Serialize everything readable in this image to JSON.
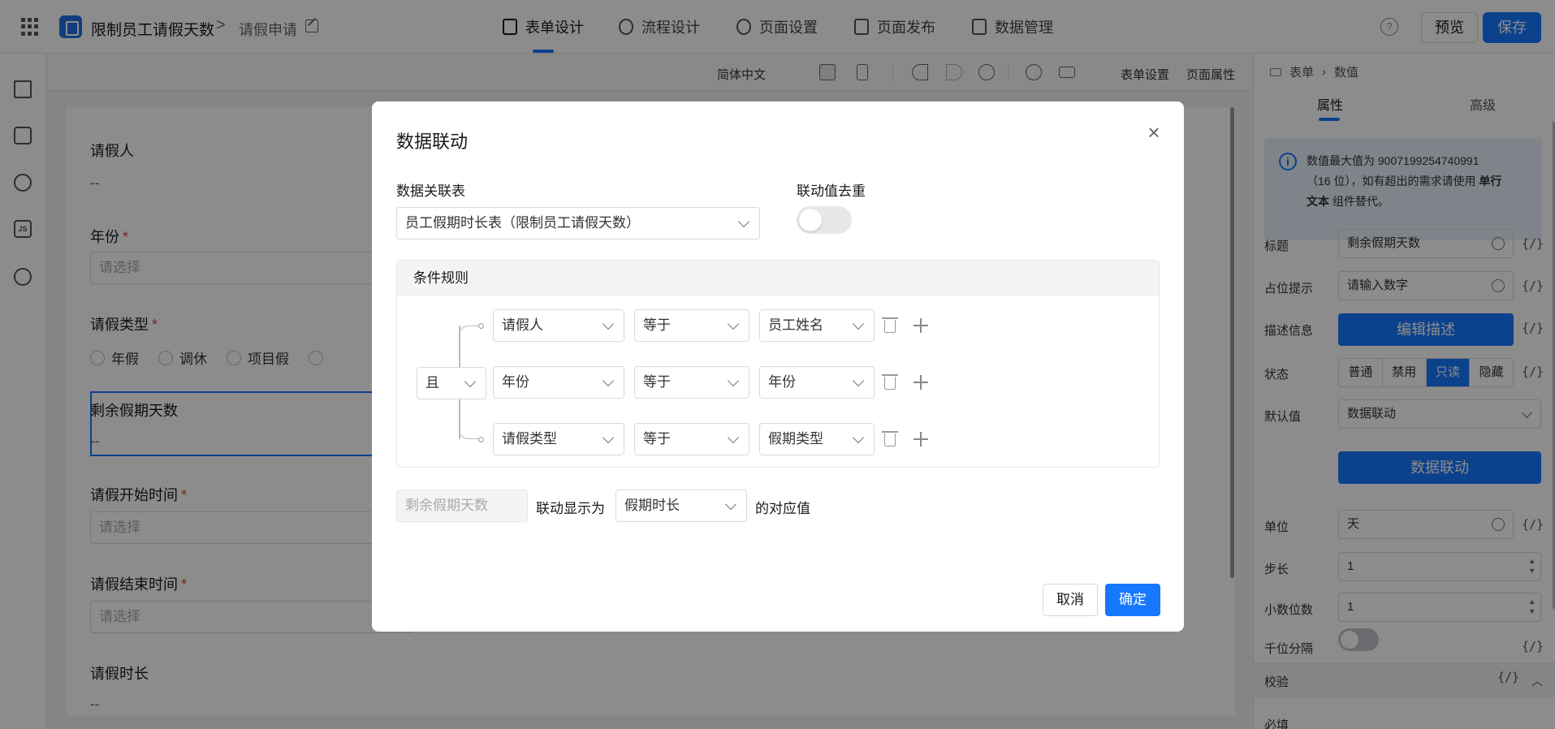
{
  "header": {
    "app_name": "限制员工请假天数",
    "crumb_sep": ">",
    "page_name": "请假申请",
    "nav_tabs": [
      {
        "label": "表单设计",
        "icon": "document-icon"
      },
      {
        "label": "流程设计",
        "icon": "flow-icon"
      },
      {
        "label": "页面设置",
        "icon": "gear-icon"
      },
      {
        "label": "页面发布",
        "icon": "send-icon"
      },
      {
        "label": "数据管理",
        "icon": "grid-icon"
      }
    ],
    "help": "?",
    "preview_label": "预览",
    "save_label": "保存"
  },
  "toolbar": {
    "language": "简体中文",
    "form_settings": "表单设置",
    "page_props": "页面属性"
  },
  "canvas": {
    "fields": [
      {
        "label": "请假人",
        "value": "--"
      },
      {
        "label": "年份",
        "required": "*",
        "placeholder": "请选择"
      },
      {
        "label": "请假类型",
        "required": "*",
        "options": [
          "年假",
          "调休",
          "项目假"
        ]
      },
      {
        "label": "剩余假期天数",
        "value": "--"
      },
      {
        "label": "请假开始时间",
        "required": "*",
        "placeholder": "请选择"
      },
      {
        "label": "请假结束时间",
        "required": "*",
        "placeholder": "请选择"
      },
      {
        "label": "请假时长",
        "value": "--"
      }
    ]
  },
  "right_panel": {
    "crumb_icon": "form-icon",
    "crumb_a": "表单",
    "crumb_b": "数值",
    "tabs": [
      "属性",
      "高级"
    ],
    "info": {
      "icon": "info-icon",
      "line1": "数值最大值为 9007199254740991",
      "line2": "（16 位），如有超出的需求请使用",
      "bold1": "单行",
      "bold2": "文本",
      "tail": "组件替代。"
    },
    "rows": {
      "title_label": "标题",
      "title_value": "剩余假期天数",
      "placeholder_label": "占位提示",
      "placeholder_value": "请输入数字",
      "desc_label": "描述信息",
      "desc_button": "编辑描述",
      "state_label": "状态",
      "state_options": [
        "普通",
        "禁用",
        "只读",
        "隐藏"
      ],
      "state_selected": "只读",
      "default_label": "默认值",
      "default_value": "数据联动",
      "linkage_button": "数据联动",
      "unit_label": "单位",
      "unit_value": "天",
      "step_label": "步长",
      "step_value": "1",
      "decimal_label": "小数位数",
      "decimal_value": "1",
      "thousand_label": "千位分隔",
      "fx": "{/}"
    },
    "section_validate": "校验",
    "required_label": "必填"
  },
  "modal": {
    "title": "数据联动",
    "close": "×",
    "table_label": "数据关联表",
    "table_value": "员工假期时长表（限制员工请假天数）",
    "dedupe_label": "联动值去重",
    "rule_head": "条件规则",
    "logic": "且",
    "rules": [
      {
        "field": "请假人",
        "op": "等于",
        "target": "员工姓名"
      },
      {
        "field": "年份",
        "op": "等于",
        "target": "年份"
      },
      {
        "field": "请假类型",
        "op": "等于",
        "target": "假期类型"
      }
    ],
    "display_field": "剩余假期天数",
    "display_as": "联动显示为",
    "display_value": "假期时长",
    "corresponding": "的对应值",
    "cancel": "取消",
    "ok": "确定"
  }
}
